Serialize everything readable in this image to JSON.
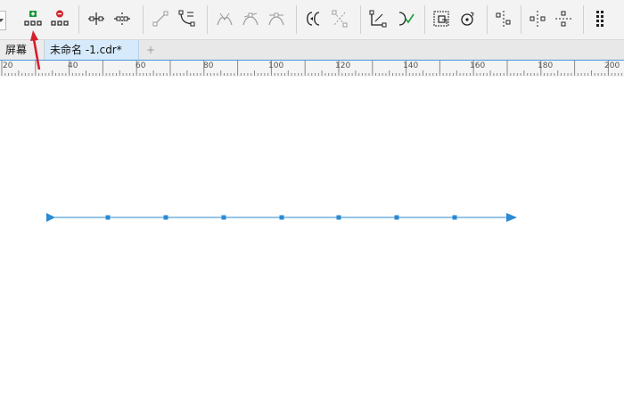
{
  "toolbar": {
    "buttons": [
      {
        "name": "add-node-icon"
      },
      {
        "name": "delete-node-icon"
      },
      {
        "name": "join-nodes-icon"
      },
      {
        "name": "break-curve-icon"
      },
      {
        "name": "to-line-icon"
      },
      {
        "name": "to-curve-icon"
      },
      {
        "name": "cusp-node-icon"
      },
      {
        "name": "smooth-node-icon"
      },
      {
        "name": "symmetrical-node-icon"
      },
      {
        "name": "reverse-direction-icon"
      },
      {
        "name": "extend-curve-icon"
      },
      {
        "name": "extract-subpath-icon"
      },
      {
        "name": "close-curve-icon"
      },
      {
        "name": "stretch-scale-nodes-icon"
      },
      {
        "name": "rotate-skew-nodes-icon"
      },
      {
        "name": "align-nodes-icon"
      },
      {
        "name": "horizontal-reflection-icon"
      },
      {
        "name": "vertical-reflection-icon"
      },
      {
        "name": "select-all-nodes-icon"
      }
    ],
    "accent_add": "#1a9a3c",
    "accent_delete": "#d2202a"
  },
  "tabs": {
    "left_tab": "屏幕",
    "active_tab": "未命名 -1.cdr*",
    "add_tab": "+"
  },
  "ruler": {
    "labels": [
      "20",
      "40",
      "60",
      "80",
      "100",
      "120",
      "140",
      "160",
      "180",
      "200"
    ]
  },
  "drawing": {
    "line_color": "#2a8ad4",
    "arrow_color": "#d51f2c",
    "node_count": 7
  }
}
